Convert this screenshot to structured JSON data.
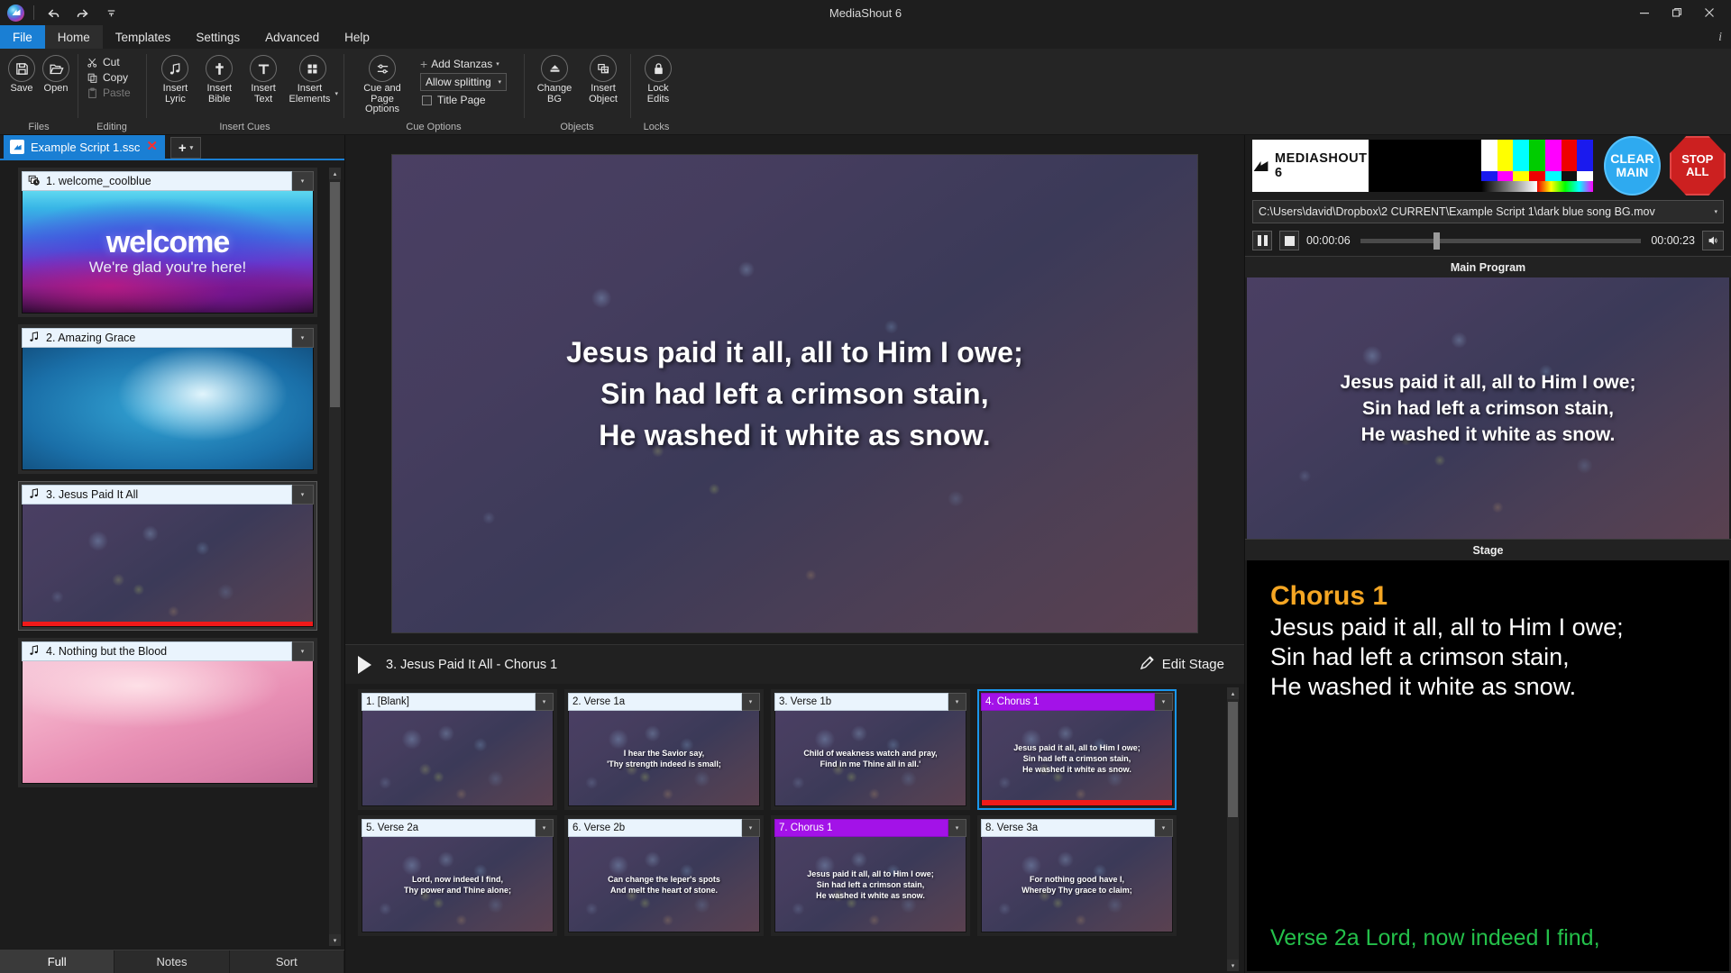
{
  "window": {
    "title": "MediaShout 6",
    "minimize": "minimize-icon",
    "maximize": "restore-icon",
    "close": "close-icon",
    "info": "i"
  },
  "quick_access": {
    "logo": "mediashout-logo-icon",
    "undo": "undo-icon",
    "redo": "redo-icon",
    "more": "quick-access-more-icon"
  },
  "menu": {
    "items": [
      {
        "label": "File",
        "state": "file"
      },
      {
        "label": "Home",
        "state": "active"
      },
      {
        "label": "Templates",
        "state": ""
      },
      {
        "label": "Settings",
        "state": ""
      },
      {
        "label": "Advanced",
        "state": ""
      },
      {
        "label": "Help",
        "state": ""
      }
    ]
  },
  "ribbon": {
    "groups": [
      {
        "name": "Files",
        "label": "Files",
        "buttons": [
          {
            "label": "Save",
            "icon": "save-icon"
          },
          {
            "label": "Open",
            "icon": "open-folder-icon"
          }
        ]
      },
      {
        "name": "Editing",
        "label": "Editing",
        "small_buttons": [
          {
            "label": "Cut",
            "icon": "scissors-icon",
            "enabled": true
          },
          {
            "label": "Copy",
            "icon": "copy-icon",
            "enabled": true
          },
          {
            "label": "Paste",
            "icon": "paste-icon",
            "enabled": false
          }
        ]
      },
      {
        "name": "Insert Cues",
        "label": "Insert Cues",
        "buttons": [
          {
            "label": "Insert Lyric",
            "icon": "music-note-plus-icon"
          },
          {
            "label": "Insert Bible",
            "icon": "cross-plus-icon"
          },
          {
            "label": "Insert Text",
            "icon": "text-t-plus-icon"
          },
          {
            "label": "Insert Elements",
            "icon": "grid-plus-icon",
            "has_caret": true
          }
        ]
      },
      {
        "name": "Cue Options",
        "label": "Cue Options",
        "buttons": [
          {
            "label": "Cue and Page Options",
            "icon": "sliders-icon"
          }
        ],
        "stanzas": {
          "add_stanzas_label": "Add Stanzas",
          "splitting_value": "Allow splitting",
          "title_page_label": "Title Page",
          "title_page_checked": false
        }
      },
      {
        "name": "Objects",
        "label": "Objects",
        "buttons": [
          {
            "label": "Change BG",
            "icon": "background-icon",
            "has_caret": true
          },
          {
            "label": "Insert Object",
            "icon": "insert-object-icon",
            "has_caret": true
          }
        ]
      },
      {
        "name": "Locks",
        "label": "Locks",
        "buttons": [
          {
            "label": "Lock Edits",
            "icon": "padlock-icon"
          }
        ]
      }
    ]
  },
  "script_tabs": {
    "active_tab": "Example Script 1.ssc",
    "close_icon": "close-tab-icon",
    "add_label": "+",
    "add_caret": "▾"
  },
  "cues": [
    {
      "number": "1.",
      "title": "1. welcome_coolblue",
      "icon": "image-clock-icon",
      "bg": "bg-welcome",
      "live": false,
      "overlay_title": "welcome",
      "overlay_sub": "We're glad you're here!"
    },
    {
      "number": "2.",
      "title": "2. Amazing Grace",
      "icon": "music-note-icon",
      "bg": "bg-amazing",
      "live": false,
      "overlay_title": "",
      "overlay_sub": ""
    },
    {
      "number": "3.",
      "title": "3. Jesus Paid It All",
      "icon": "music-note-icon",
      "bg": "bg-dark",
      "live": true,
      "overlay_title": "",
      "overlay_sub": ""
    },
    {
      "number": "4.",
      "title": "4. Nothing but the Blood",
      "icon": "music-note-icon",
      "bg": "bg-pink",
      "live": false,
      "overlay_title": "",
      "overlay_sub": ""
    }
  ],
  "left_bottom_tabs": [
    {
      "label": "Full",
      "active": true
    },
    {
      "label": "Notes",
      "active": false
    },
    {
      "label": "Sort",
      "active": false
    }
  ],
  "preview": {
    "lines": [
      "Jesus paid it all, all to Him I owe;",
      "Sin had left a crimson stain,",
      "He washed it white as snow."
    ]
  },
  "cue_header": {
    "play_icon": "play-icon",
    "cue_name": "3. Jesus Paid It All  -  Chorus 1",
    "edit_stage_label": "Edit Stage",
    "edit_stage_icon": "pencil-icon"
  },
  "pages": [
    {
      "label": "1. [Blank]",
      "kind": "normal",
      "selected": false,
      "live": false,
      "lines": []
    },
    {
      "label": "2. Verse 1a",
      "kind": "normal",
      "selected": false,
      "live": false,
      "lines": [
        "I hear the Savior say,",
        "'Thy strength indeed is small;"
      ]
    },
    {
      "label": "3. Verse 1b",
      "kind": "normal",
      "selected": false,
      "live": false,
      "lines": [
        "Child of weakness watch and pray,",
        "Find in me Thine all in all.'"
      ]
    },
    {
      "label": "4. Chorus 1",
      "kind": "chorus",
      "selected": true,
      "live": true,
      "lines": [
        "Jesus paid it all, all to Him I owe;",
        "Sin had left a crimson stain,",
        "He washed it white as snow."
      ]
    },
    {
      "label": "5. Verse 2a",
      "kind": "normal",
      "selected": false,
      "live": false,
      "lines": [
        "Lord, now indeed I find,",
        "Thy power and Thine alone;"
      ]
    },
    {
      "label": "6. Verse 2b",
      "kind": "normal",
      "selected": false,
      "live": false,
      "lines": [
        "Can change the leper's spots",
        "And melt the heart of stone."
      ]
    },
    {
      "label": "7. Chorus 1",
      "kind": "chorus",
      "selected": false,
      "live": false,
      "lines": [
        "Jesus paid it all, all to Him I owe;",
        "Sin had left a crimson stain,",
        "He washed it white as snow."
      ]
    },
    {
      "label": "8. Verse 3a",
      "kind": "normal",
      "selected": false,
      "live": false,
      "lines": [
        "For nothing good have I,",
        "Whereby Thy grace to claim;"
      ]
    }
  ],
  "control_bar": {
    "logo_text": "MEDIASHOUT 6",
    "clear_main_line1": "CLEAR",
    "clear_main_line2": "MAIN",
    "stop_all_line1": "STOP",
    "stop_all_line2": "ALL",
    "clear_main_color": "#2eaaf0",
    "stop_all_color": "#cc2020"
  },
  "media_player": {
    "path": "C:\\Users\\david\\Dropbox\\2 CURRENT\\Example Script 1\\dark blue song BG.mov",
    "pause_icon": "pause-icon",
    "stop_icon": "stop-icon",
    "elapsed": "00:00:06",
    "duration": "00:00:23",
    "volume_icon": "volume-icon",
    "progress_percent": 26
  },
  "main_program": {
    "label": "Main Program",
    "lines": [
      "Jesus paid it all, all to Him I owe;",
      "Sin had left a crimson stain,",
      "He washed it white as snow."
    ]
  },
  "stage_display": {
    "label": "Stage",
    "title": "Chorus 1",
    "title_color": "#f5a623",
    "lines": [
      "Jesus paid it all, all to Him I owe;",
      "Sin had left a crimson stain,",
      "He washed it white as snow."
    ],
    "next_text": "Verse 2a Lord, now indeed I find,",
    "next_color": "#24c04a"
  }
}
